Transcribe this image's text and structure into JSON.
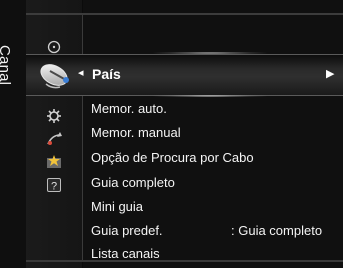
{
  "menu": {
    "section_label": "Canal",
    "selected_item": "País",
    "items": [
      {
        "label": "Memor. auto."
      },
      {
        "label": "Memor. manual"
      },
      {
        "label": "Opção de Procura por Cabo"
      },
      {
        "label": "Guia completo"
      },
      {
        "label": "Mini guia"
      },
      {
        "label": "Guia predef.",
        "value": ": Guia completo"
      },
      {
        "label": "Lista canais"
      }
    ]
  },
  "icons": {
    "top": "circle-icon",
    "selected": "satellite-dish-icon",
    "others": [
      "gear-icon",
      "settings-arrow-icon",
      "star-picture-icon",
      "help-icon"
    ]
  },
  "colors": {
    "background": "#0b0b0b",
    "text": "#f4f4f4",
    "highlight": "#2f2f2f"
  }
}
